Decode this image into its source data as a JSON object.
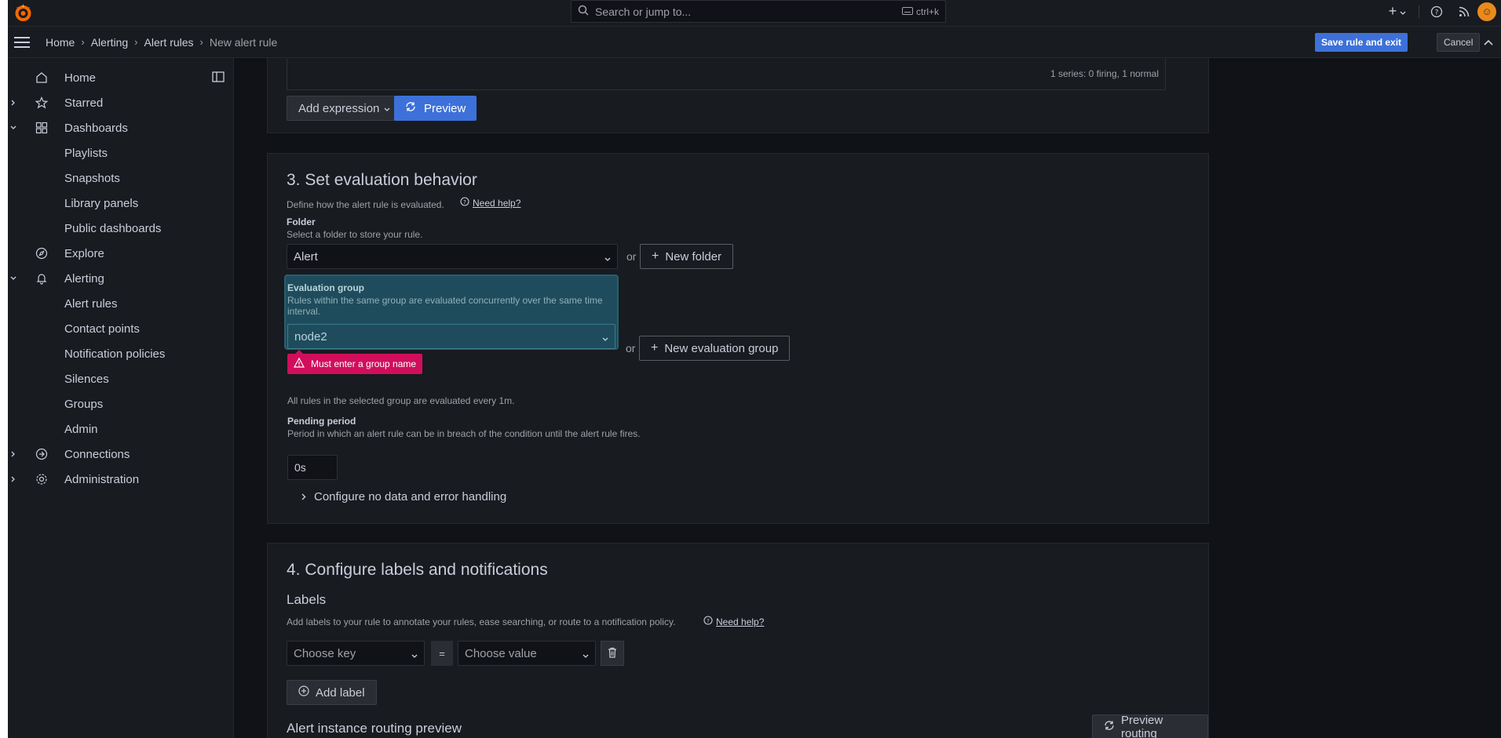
{
  "topbar": {
    "search_placeholder": "Search or jump to...",
    "search_shortcut": "ctrl+k",
    "avatar_initial": "☺"
  },
  "breadcrumb": {
    "items": [
      "Home",
      "Alerting",
      "Alert rules"
    ],
    "current": "New alert rule"
  },
  "actions": {
    "save_label": "Save rule and exit",
    "cancel_label": "Cancel"
  },
  "sidebar": {
    "items": [
      {
        "label": "Home"
      },
      {
        "label": "Starred"
      },
      {
        "label": "Dashboards"
      },
      {
        "label": "Playlists"
      },
      {
        "label": "Snapshots"
      },
      {
        "label": "Library panels"
      },
      {
        "label": "Public dashboards"
      },
      {
        "label": "Explore"
      },
      {
        "label": "Alerting"
      },
      {
        "label": "Alert rules"
      },
      {
        "label": "Contact points"
      },
      {
        "label": "Notification policies"
      },
      {
        "label": "Silences"
      },
      {
        "label": "Groups"
      },
      {
        "label": "Admin"
      },
      {
        "label": "Connections"
      },
      {
        "label": "Administration"
      }
    ]
  },
  "query": {
    "series_info": "1 series: 0 firing, 1 normal",
    "add_expression_label": "Add expression",
    "preview_label": "Preview"
  },
  "section3": {
    "title": "3. Set evaluation behavior",
    "description": "Define how the alert rule is evaluated.",
    "help_label": "Need help?",
    "folder": {
      "label": "Folder",
      "description": "Select a folder to store your rule.",
      "value": "Alert",
      "or_text": "or",
      "new_button": "New folder"
    },
    "eval_group": {
      "label": "Evaluation group",
      "description": "Rules within the same group are evaluated concurrently over the same time interval.",
      "value": "node2",
      "or_text": "or",
      "new_button": "New evaluation group",
      "error": "Must enter a group name",
      "info": "All rules in the selected group are evaluated every 1m."
    },
    "pending": {
      "label": "Pending period",
      "description": "Period in which an alert rule can be in breach of the condition until the alert rule fires.",
      "value": "0s"
    },
    "no_data_toggle": "Configure no data and error handling"
  },
  "section4": {
    "title": "4. Configure labels and notifications",
    "labels_heading": "Labels",
    "labels_description": "Add labels to your rule to annotate your rules, ease searching, or route to a notification policy.",
    "help_label": "Need help?",
    "key_placeholder": "Choose key",
    "equals": "=",
    "value_placeholder": "Choose value",
    "add_label": "Add label",
    "routing_heading": "Alert instance routing preview",
    "preview_routing": "Preview routing"
  }
}
